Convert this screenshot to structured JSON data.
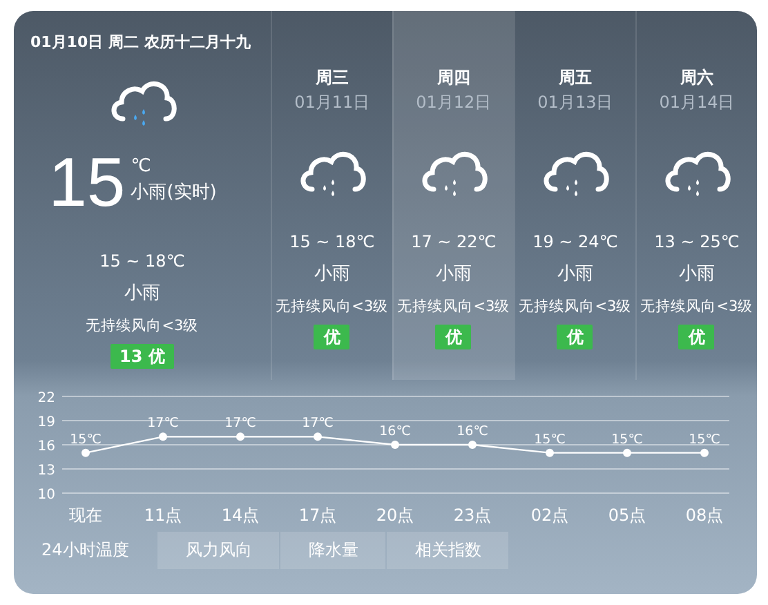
{
  "header": {
    "date": "01月10日 周二 农历十二月十九"
  },
  "today": {
    "temp": "15",
    "unit": "℃",
    "condition": "小雨(实时)",
    "range": "15 ~ 18℃",
    "weather": "小雨",
    "wind": "无持续风向<3级",
    "aqi": "13 优"
  },
  "days": [
    {
      "weekday": "周三",
      "date": "01月11日",
      "range": "15 ~ 18℃",
      "weather": "小雨",
      "wind": "无持续风向<3级",
      "aqi": "优",
      "selected": false
    },
    {
      "weekday": "周四",
      "date": "01月12日",
      "range": "17 ~ 22℃",
      "weather": "小雨",
      "wind": "无持续风向<3级",
      "aqi": "优",
      "selected": true
    },
    {
      "weekday": "周五",
      "date": "01月13日",
      "range": "19 ~ 24℃",
      "weather": "小雨",
      "wind": "无持续风向<3级",
      "aqi": "优",
      "selected": false
    },
    {
      "weekday": "周六",
      "date": "01月14日",
      "range": "13 ~ 25℃",
      "weather": "小雨",
      "wind": "无持续风向<3级",
      "aqi": "优",
      "selected": false
    }
  ],
  "chart_data": {
    "type": "line",
    "categories": [
      "现在",
      "11点",
      "14点",
      "17点",
      "20点",
      "23点",
      "02点",
      "05点",
      "08点"
    ],
    "series": [
      {
        "color": "#ffffff",
        "marker": true,
        "values": [
          15,
          17,
          17,
          17,
          16,
          16,
          15,
          15,
          15
        ]
      }
    ],
    "grid": true,
    "value_labels": [
      "15℃",
      "17℃",
      "17℃",
      "17℃",
      "16℃",
      "16℃",
      "15℃",
      "15℃",
      "15℃"
    ],
    "ylim": [
      10,
      22
    ],
    "yticks": [
      22,
      19,
      16,
      13,
      10
    ]
  },
  "tabs": [
    {
      "label": "24小时温度",
      "selected": true
    },
    {
      "label": "风力风向",
      "selected": false
    },
    {
      "label": "降水量",
      "selected": false
    },
    {
      "label": "相关指数",
      "selected": false
    }
  ]
}
